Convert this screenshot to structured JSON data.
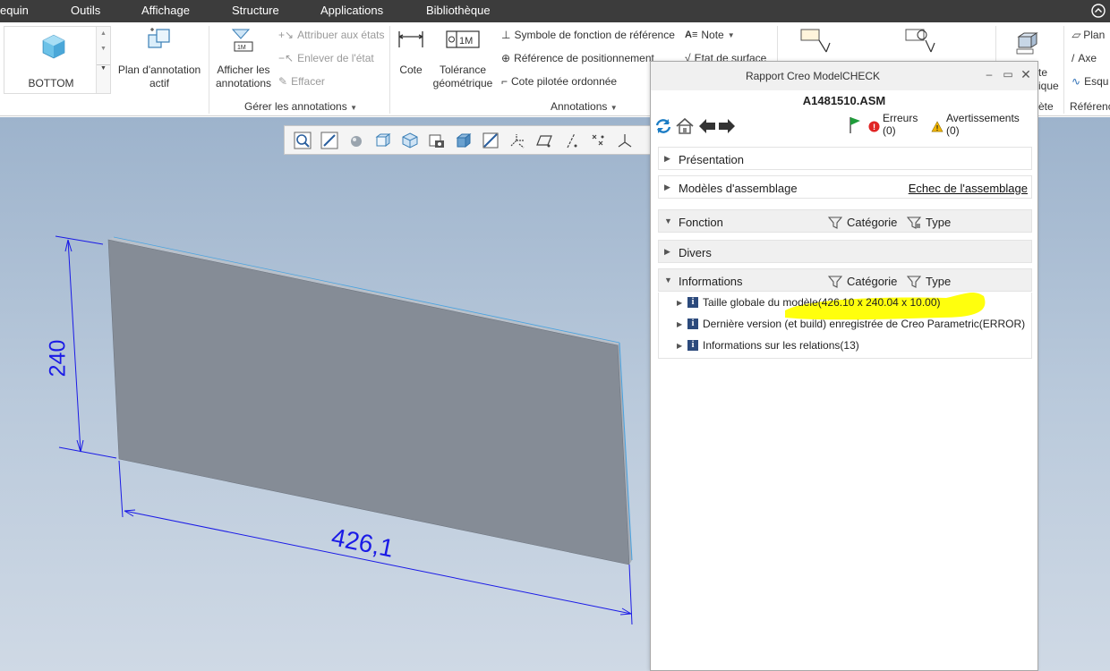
{
  "menu": {
    "items": [
      "equin",
      "Outils",
      "Affichage",
      "Structure",
      "Applications",
      "Bibliothèque"
    ]
  },
  "ribbon": {
    "view_name": "BOTTOM",
    "active_plan": "Plan d'annotation actif",
    "show_annotations": "Afficher les annotations",
    "assign_states": "Attribuer aux états",
    "remove_state": "Enlever de l'état",
    "erase": "Effacer",
    "manage_annotations": "Gérer les annotations",
    "dimension": "Cote",
    "geometric_tolerance": "Tolérance géométrique",
    "datum_feature_symbol": "Symbole de fonction de référence",
    "datum_target": "Référence de positionnement",
    "ordinate_dimension": "Cote pilotée ordonnée",
    "note": "Note",
    "surface_finish": "Etat de surface",
    "annotations_group": "Annotations",
    "cut_label_1": "te",
    "cut_label_2": "ique",
    "cut_label_3": "ète",
    "plane": "Plan",
    "axis": "Axe",
    "sketch": "Esqu",
    "references": "Référenc"
  },
  "viewport": {
    "dim_vertical": "240",
    "dim_horizontal": "426,1",
    "dim_color": "#1a1ae6",
    "plate_color": "#858c96"
  },
  "dialog": {
    "title": "Rapport Creo ModelCHECK",
    "model_name": "A1481510.ASM",
    "errors_label": "Erreurs",
    "errors_count": "(0)",
    "warnings_label": "Avertissements",
    "warnings_count": "(0)",
    "sections": {
      "presentation": "Présentation",
      "assembly_models": "Modèles d'assemblage",
      "assembly_failure_link": "Echec de l'assemblage",
      "function": "Fonction",
      "misc": "Divers",
      "information": "Informations"
    },
    "filters": {
      "category": "Catégorie",
      "type": "Type"
    },
    "info_rows": [
      "Taille globale du modèle(426.10 x 240.04 x 10.00)",
      "Dernière version (et build) enregistrée de Creo Parametric(ERROR)",
      "Informations sur les relations(13)"
    ],
    "highlight_color": "#ffff00"
  }
}
